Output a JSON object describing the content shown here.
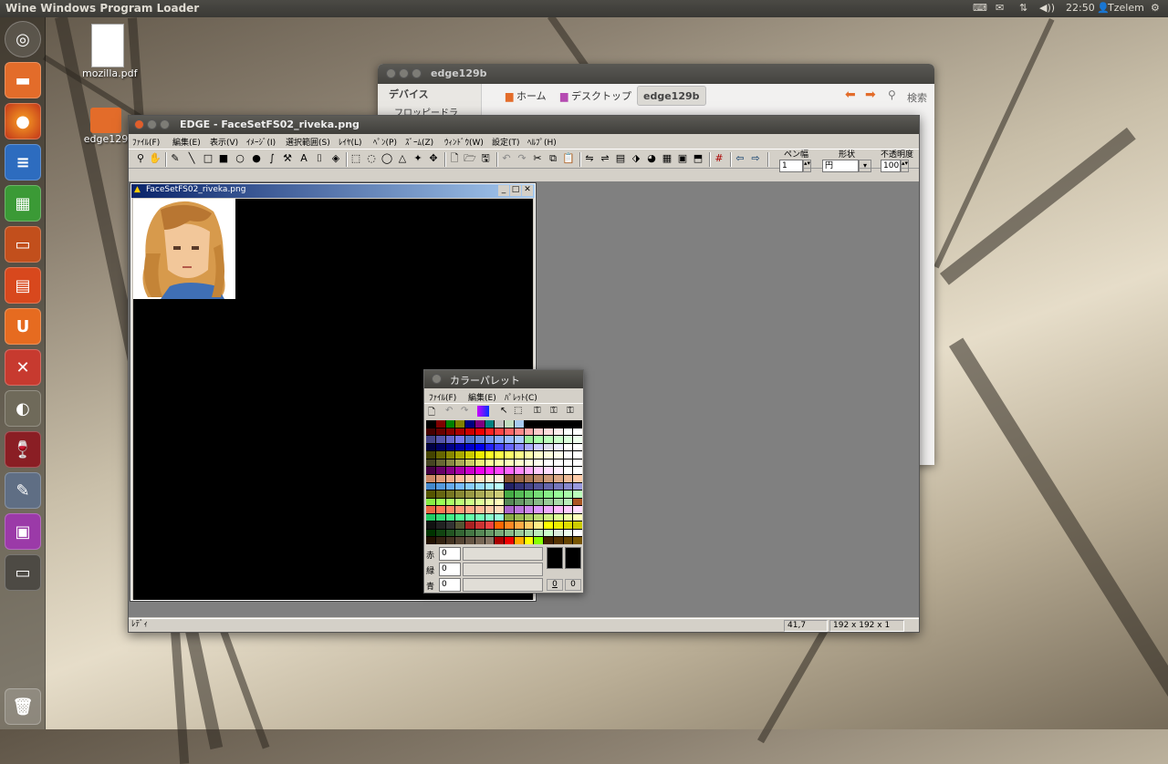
{
  "panel": {
    "title": "Wine Windows Program Loader",
    "time": "22:50",
    "user": "Tzelem",
    "volume": "◀))"
  },
  "desktop": {
    "icons": [
      {
        "label": "mozilla.pdf"
      },
      {
        "label": "edge129"
      }
    ]
  },
  "launcher": {
    "items": [
      "dash-icon",
      "files-icon",
      "firefox-icon",
      "writer-icon",
      "calc-icon",
      "impress-icon",
      "software-center-icon",
      "ubuntu-one-icon",
      "settings-icon",
      "gimp-icon",
      "wine-icon",
      "inkscape-icon",
      "remote-desktop-icon",
      "workspace-icon",
      "trash-icon"
    ]
  },
  "filemanager": {
    "title": "edge129b",
    "sidebar_heading": "デバイス",
    "sidebar_item": "フロッピードラ",
    "crumbs": [
      "ホーム",
      "デスクトップ",
      "edge129b"
    ],
    "search": "検索"
  },
  "edge": {
    "title": "EDGE - FaceSetFS02_riveka.png",
    "menu": [
      "ﾌｧｲﾙ(F)",
      "編集(E)",
      "表示(V)",
      "ｲﾒｰｼﾞ(I)",
      "選択範囲(S)",
      "ﾚｲﾔ(L)",
      "ﾍﾟﾝ(P)",
      "ｽﾞｰﾑ(Z)",
      "ｳｨﾝﾄﾞｳ(W)",
      "設定(T)",
      "ﾍﾙﾌﾟ(H)"
    ],
    "pen_width_label": "ペン幅",
    "pen_width": "1",
    "shape_label": "形状",
    "shape": "円",
    "opacity_label": "不透明度",
    "opacity": "100",
    "status": {
      "text": "ﾚﾃﾞｨ",
      "coords": "41,7",
      "size": "192 x 192 x 1"
    }
  },
  "image_window": {
    "title": "FaceSetFS02_riveka.png"
  },
  "palette": {
    "title": "カラーパレット",
    "menu": [
      "ﾌｧｲﾙ(F)",
      "編集(E)",
      "ﾊﾟﾚｯﾄ(C)"
    ],
    "red_label": "赤",
    "green_label": "緑",
    "blue_label": "青",
    "red": "0",
    "green": "0",
    "blue": "0",
    "fg_index": "0",
    "bg_index": "0"
  }
}
